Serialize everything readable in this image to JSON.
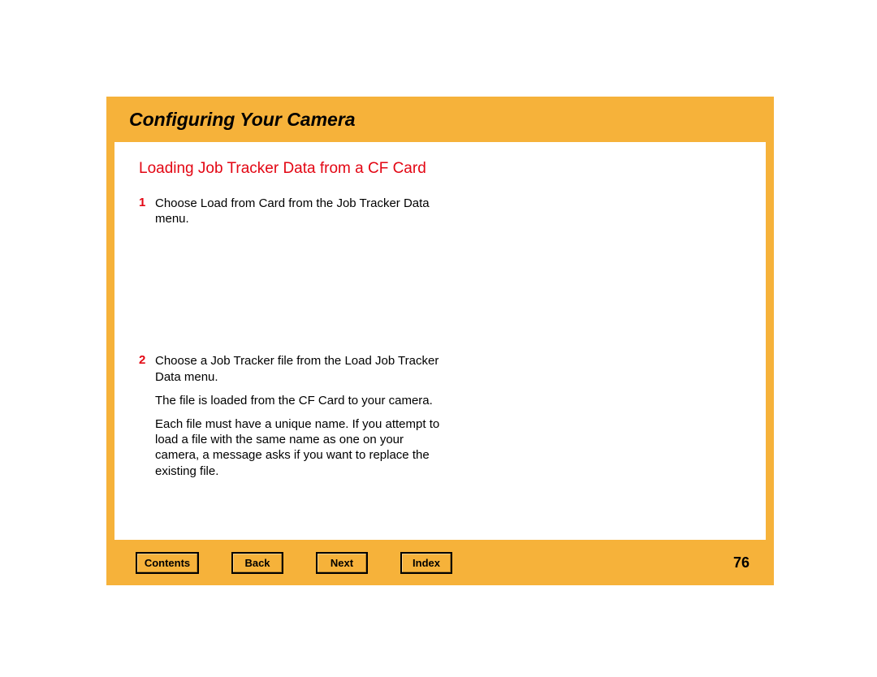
{
  "header": {
    "chapter_title": "Configuring Your Camera"
  },
  "section": {
    "heading": "Loading Job Tracker Data from a CF Card"
  },
  "steps": [
    {
      "num": "1",
      "text": "Choose Load from Card from the Job Tracker Data menu."
    },
    {
      "num": "2",
      "text": "Choose a Job Tracker file from the Load Job Tracker Data menu."
    }
  ],
  "paragraphs": [
    "The file is loaded from the CF Card to your camera.",
    "Each file must have a unique name. If you attempt to load a file with the same name as one on your camera, a message asks if you want to replace the existing file."
  ],
  "footer": {
    "contents_label": "Contents",
    "back_label": "Back",
    "next_label": "Next",
    "index_label": "Index",
    "page_number": "76"
  }
}
